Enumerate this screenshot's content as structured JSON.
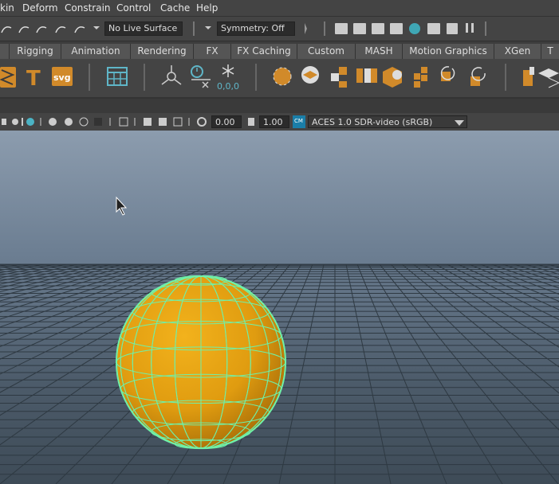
{
  "menu": [
    "kin",
    "Deform",
    "Constrain",
    "Control",
    "Cache",
    "Help"
  ],
  "status": {
    "live_surface": "No Live Surface",
    "symmetry": "Symmetry: Off"
  },
  "shelf_tabs": [
    "Rigging",
    "Animation",
    "Rendering",
    "FX",
    "FX Caching",
    "Custom",
    "MASH",
    "Motion Graphics",
    "XGen",
    "T"
  ],
  "shelf": {
    "svg_label": "svg",
    "snap_coords": "0,0,0"
  },
  "panel": {
    "exposure": "0.00",
    "gamma": "1.00",
    "color_space": "ACES 1.0 SDR-video (sRGB)",
    "cm_badge": "CM"
  },
  "icons": [
    "magnet-icon",
    "text-tool-icon",
    "svg-tool-icon",
    "render-view-icon",
    "pivot-icon",
    "timer-icon",
    "snowflake-icon",
    "polygon-icon",
    "sphere-icon",
    "cube-icon",
    "cursor-icon"
  ]
}
